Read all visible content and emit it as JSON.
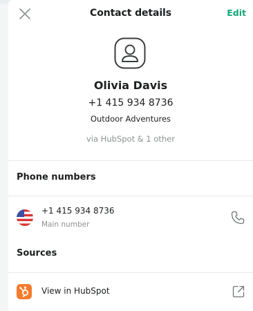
{
  "header": {
    "title": "Contact details",
    "edit_label": "Edit"
  },
  "contact": {
    "name": "Olivia Davis",
    "phone": "+1 415 934 8736",
    "company": "Outdoor Adventures",
    "via": "via HubSpot & 1 other"
  },
  "phone_numbers": {
    "title": "Phone numbers",
    "items": [
      {
        "number": "+1 415 934 8736",
        "label": "Main number"
      }
    ]
  },
  "sources": {
    "title": "Sources",
    "items": [
      {
        "label": "View in HubSpot"
      }
    ]
  },
  "colors": {
    "accent": "#17a776",
    "hubspot": "#f57c2c",
    "muted_text": "#8c9092"
  }
}
